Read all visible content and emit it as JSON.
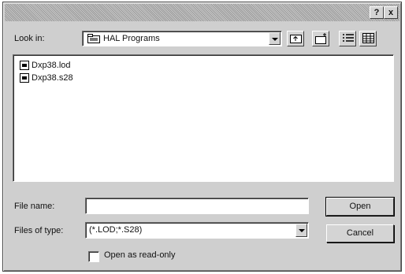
{
  "titlebar": {
    "help": "?",
    "close": "x"
  },
  "look_in": {
    "label": "Look in:",
    "value": "HAL Programs"
  },
  "toolbar": {
    "up_icon": "up-folder-icon",
    "new_folder_icon": "new-folder-icon",
    "list_icon": "list-view-icon",
    "details_icon": "details-view-icon"
  },
  "files": [
    {
      "name": "Dxp38.lod"
    },
    {
      "name": "Dxp38.s28"
    }
  ],
  "file_name": {
    "label": "File name:",
    "value": ""
  },
  "files_of_type": {
    "label": "Files of type:",
    "value": "(*.LOD;*.S28)"
  },
  "buttons": {
    "open": "Open",
    "cancel": "Cancel"
  },
  "readonly": {
    "label": "Open as read-only",
    "checked": false
  }
}
